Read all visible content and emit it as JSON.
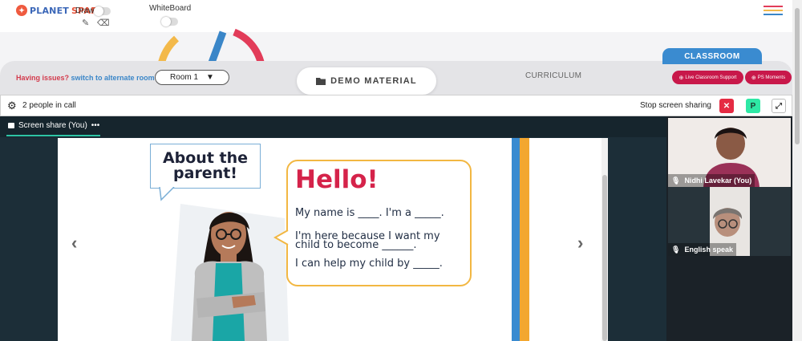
{
  "app": {
    "logo_text_1": "PLANET",
    "logo_text_2": "SPARK"
  },
  "toolbar": {
    "draw_label": "Draw",
    "whiteboard_label": "WhiteBoard",
    "draw_enabled": false,
    "whiteboard_enabled": false
  },
  "controls": {
    "issue_text": "Having issues?",
    "issue_link": "switch to alternate room",
    "room_value": "Room 1",
    "demo_material_label": "DEMO MATERIAL",
    "curriculum_label": "CURRICULUM",
    "classroom_label": "CLASSROOM",
    "support_label": "Live Classroom Support",
    "moments_label": "PS Moments"
  },
  "call": {
    "people_count_text": "2 people in call",
    "stop_share_label": "Stop screen sharing",
    "avatar_letter": "P",
    "share_tab_label": "Screen share (You)",
    "share_tab_more": "•••"
  },
  "slide": {
    "badge_title_line1": "About the",
    "badge_title_line2": "parent!",
    "greeting": "Hello!",
    "line1": "My name is ____. I'm a _____.",
    "line2a": "I'm here because I want my",
    "line2b": "child to become ______.",
    "line3": "I can help my child by _____."
  },
  "participants": [
    {
      "name": "Nidhi Lavekar (You)"
    },
    {
      "name": "English speak"
    }
  ],
  "colors": {
    "brand_red": "#d5234a",
    "brand_blue": "#3a8bd0",
    "accent_teal": "#2ec4a5",
    "stop_red": "#e52b43"
  }
}
